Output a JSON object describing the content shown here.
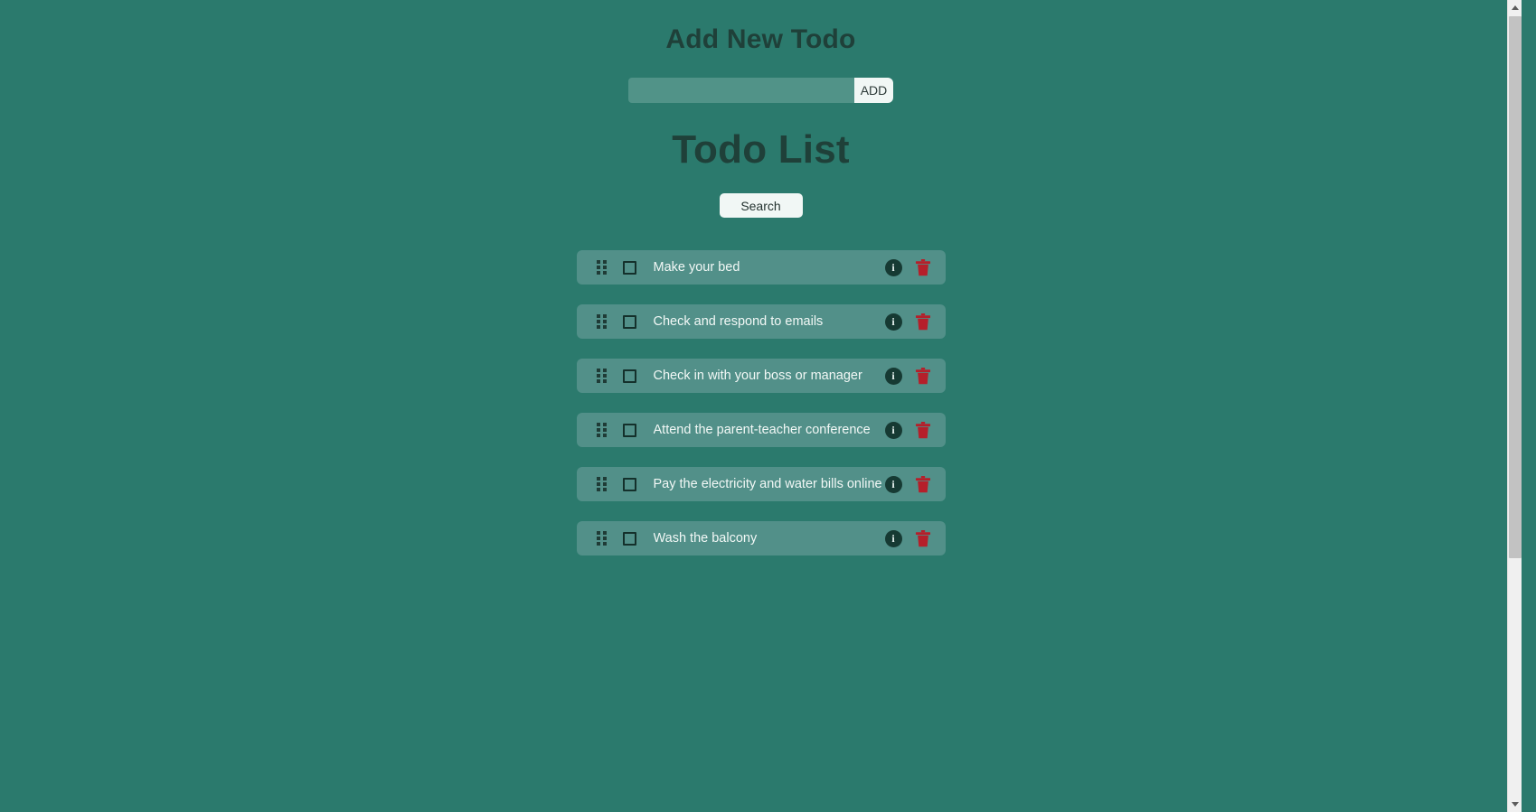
{
  "theme": {
    "page_background": "#2b7a6d",
    "row_background": "#529089",
    "heading_color": "#1f4039",
    "button_background": "#f1f7f5",
    "input_background": "#519388",
    "trash_color": "#b51f2a",
    "info_badge_color": "#163a33"
  },
  "add_section": {
    "heading": "Add New Todo",
    "input_value": "",
    "input_placeholder": "",
    "add_button_label": "ADD"
  },
  "list_section": {
    "heading": "Todo List",
    "search_button_label": "Search"
  },
  "icons": {
    "drag_handle": "drag-handle-icon",
    "checkbox": "checkbox-icon",
    "info": "i",
    "trash": "trash-icon",
    "scroll_up": "chevron-up-icon",
    "scroll_down": "chevron-down-icon"
  },
  "todos": [
    {
      "text": "Make your bed",
      "checked": false
    },
    {
      "text": "Check and respond to emails",
      "checked": false
    },
    {
      "text": "Check in with your boss or manager",
      "checked": false
    },
    {
      "text": "Attend the parent-teacher conference",
      "checked": false
    },
    {
      "text": "Pay the electricity and water bills online",
      "checked": false
    },
    {
      "text": "Wash the balcony",
      "checked": false
    }
  ]
}
